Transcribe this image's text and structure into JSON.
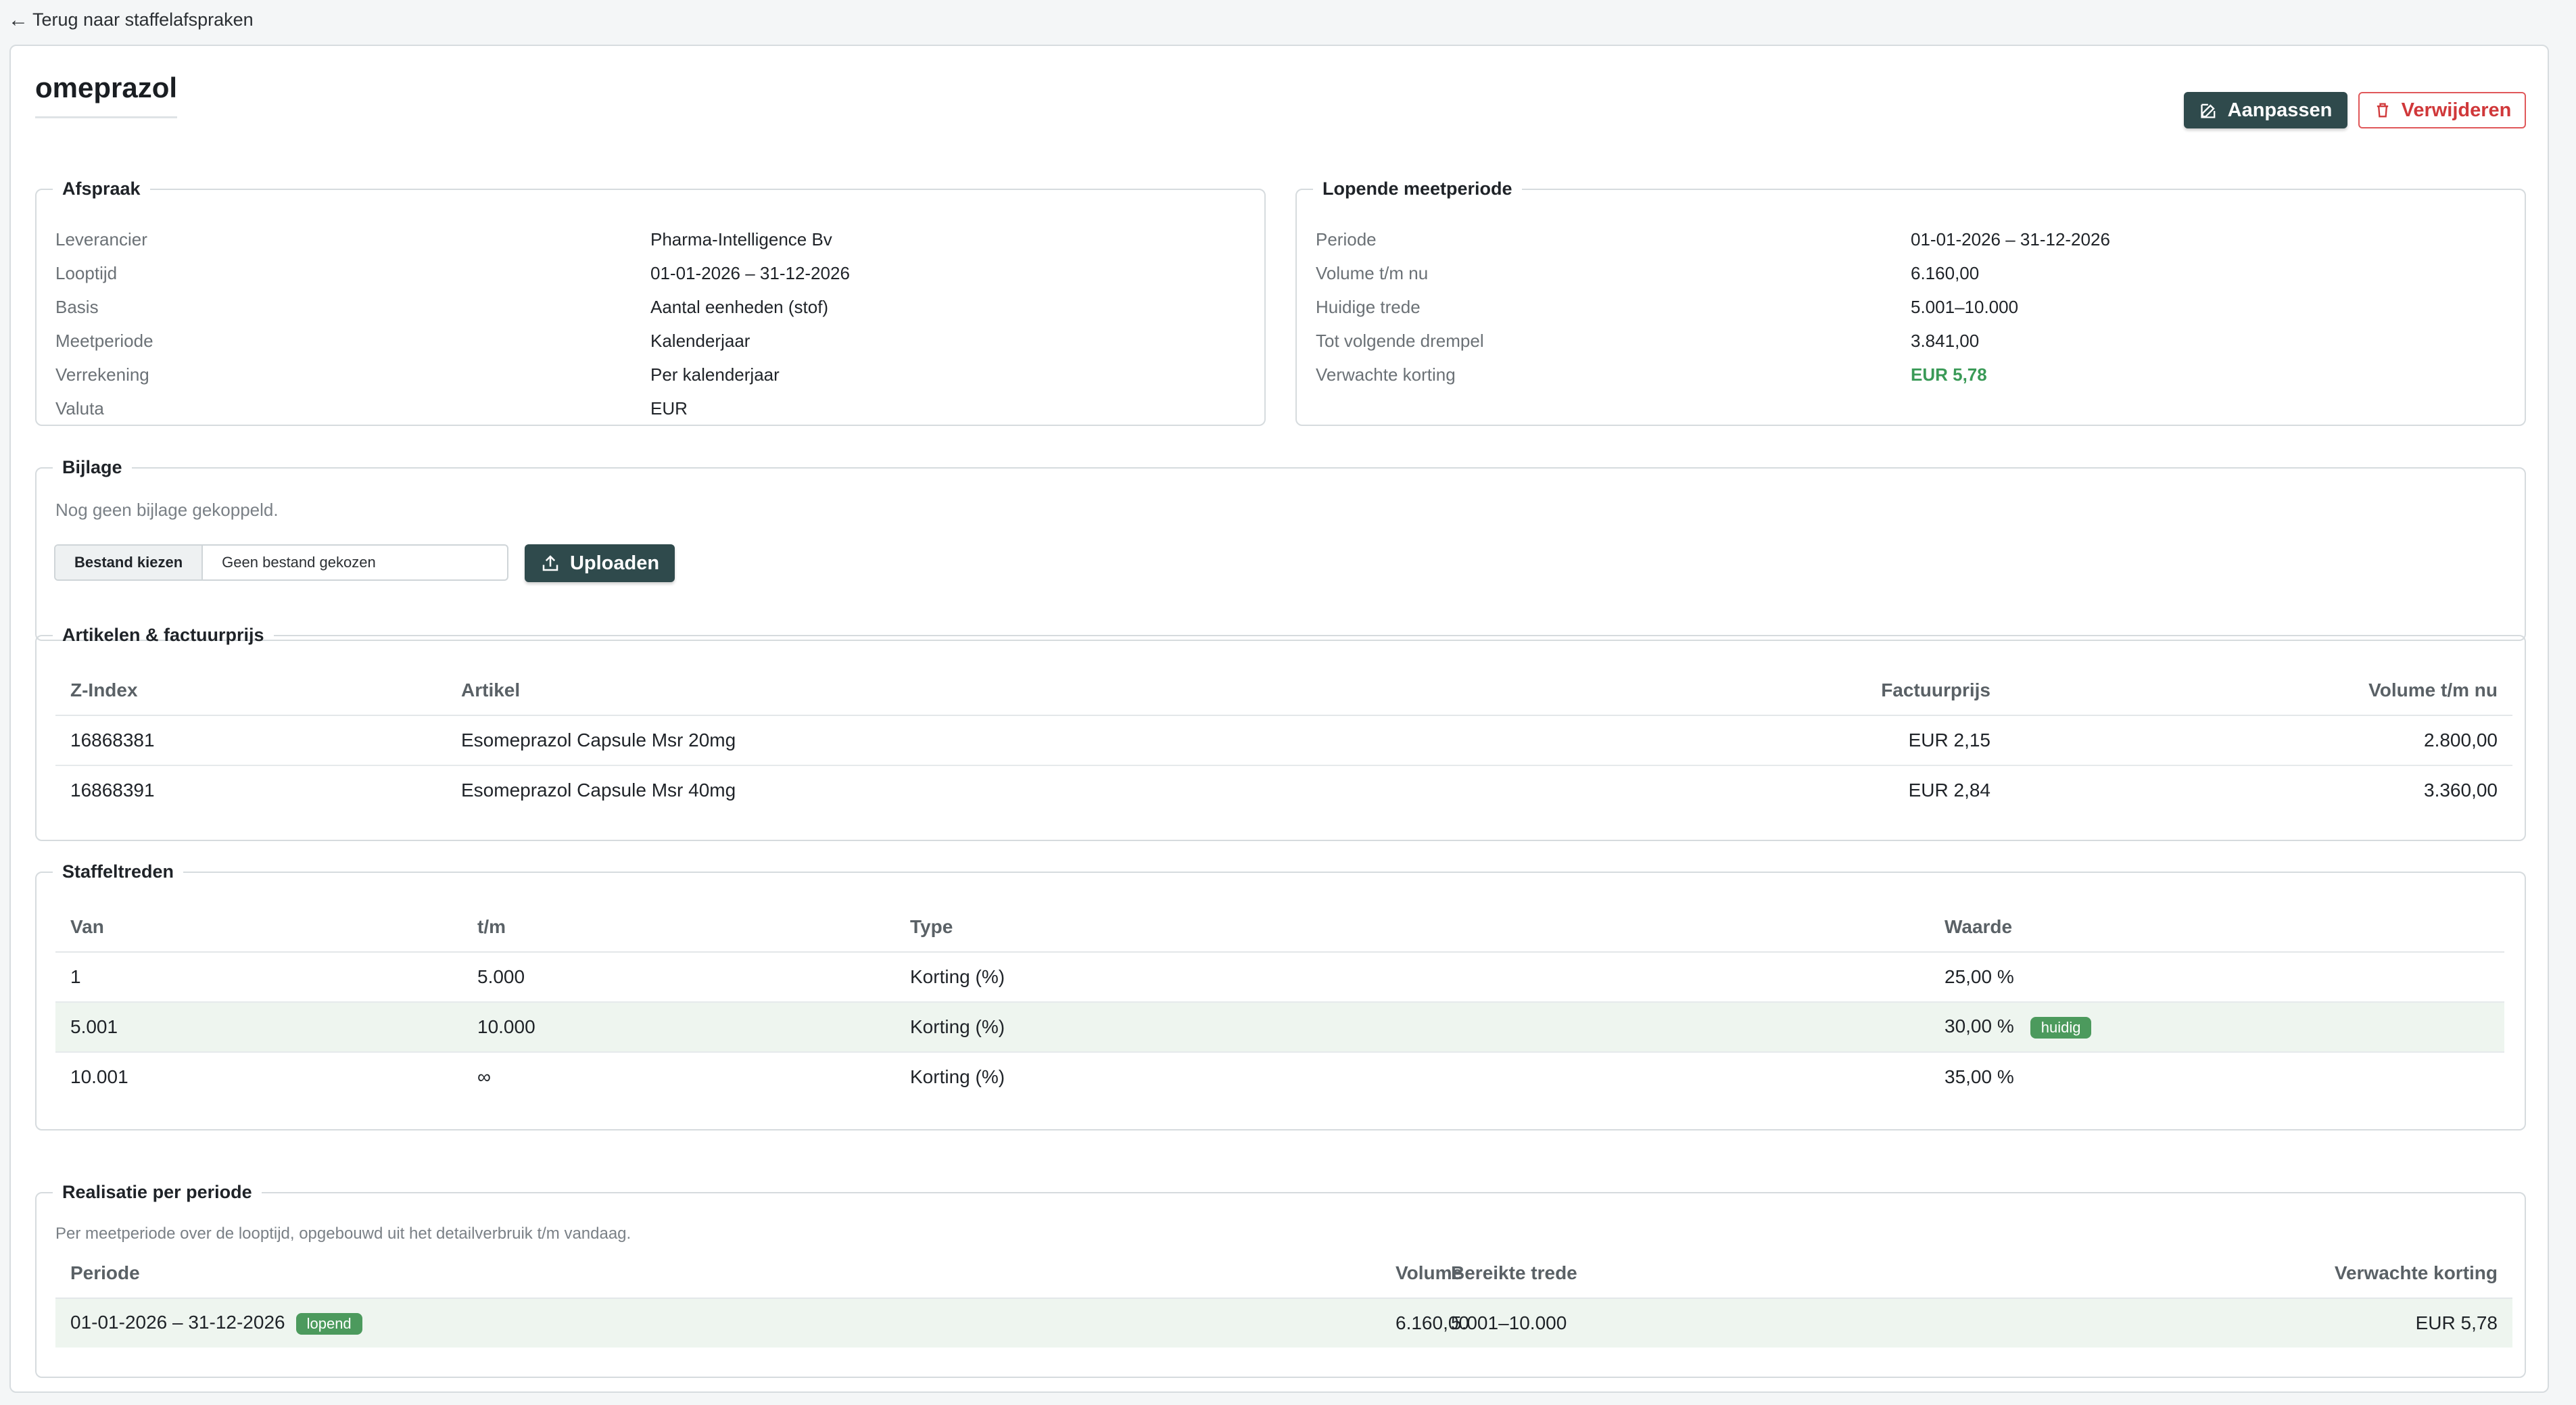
{
  "nav": {
    "back_label": "Terug naar staffelafspraken"
  },
  "page": {
    "title": "omeprazol"
  },
  "actions": {
    "edit_label": "Aanpassen",
    "delete_label": "Verwijderen"
  },
  "afspraak": {
    "legend": "Afspraak",
    "rows": [
      {
        "k": "Leverancier",
        "v": "Pharma-Intelligence Bv"
      },
      {
        "k": "Looptijd",
        "v": "01-01-2026 – 31-12-2026"
      },
      {
        "k": "Basis",
        "v": "Aantal eenheden (stof)"
      },
      {
        "k": "Meetperiode",
        "v": "Kalenderjaar"
      },
      {
        "k": "Verrekening",
        "v": "Per kalenderjaar"
      },
      {
        "k": "Valuta",
        "v": "EUR"
      }
    ]
  },
  "meetperiode": {
    "legend": "Lopende meetperiode",
    "rows": [
      {
        "k": "Periode",
        "v": "01-01-2026 – 31-12-2026"
      },
      {
        "k": "Volume t/m nu",
        "v": "6.160,00"
      },
      {
        "k": "Huidige trede",
        "v": "5.001–10.000"
      },
      {
        "k": "Tot volgende drempel",
        "v": "3.841,00"
      },
      {
        "k": "Verwachte korting",
        "v": "EUR 5,78"
      }
    ],
    "highlight_color": "#3a9a57"
  },
  "bijlage": {
    "legend": "Bijlage",
    "note": "Nog geen bijlage gekoppeld.",
    "choose_label": "Bestand kiezen",
    "no_file_label": "Geen bestand gekozen",
    "upload_label": "Uploaden"
  },
  "artikelen": {
    "legend": "Artikelen & factuurprijs",
    "headers": [
      "Z-Index",
      "Artikel",
      "Factuurprijs",
      "Volume t/m nu"
    ],
    "rows": [
      [
        "16868381",
        "Esomeprazol Capsule Msr 20mg",
        "EUR 2,15",
        "2.800,00"
      ],
      [
        "16868391",
        "Esomeprazol Capsule Msr 40mg",
        "EUR 2,84",
        "3.360,00"
      ]
    ]
  },
  "staffel": {
    "legend": "Staffeltreden",
    "headers": [
      "Van",
      "t/m",
      "Type",
      "Waarde"
    ],
    "rows": [
      [
        "1",
        "5.000",
        "Korting (%)",
        "25,00 %"
      ],
      [
        "5.001",
        "10.000",
        "Korting (%)",
        "30,00 %"
      ],
      [
        "10.001",
        "∞",
        "Korting (%)",
        "35,00 %"
      ]
    ],
    "current_badge": "huidig"
  },
  "realisatie": {
    "legend": "Realisatie per periode",
    "note": "Per meetperiode over de looptijd, opgebouwd uit het detailverbruik t/m vandaag.",
    "headers": [
      "Periode",
      "Volume",
      "Bereikte trede",
      "Verwachte korting"
    ],
    "rows": [
      [
        "01-01-2026 – 31-12-2026",
        "6.160,00",
        "5.001–10.000",
        "EUR 5,78"
      ]
    ],
    "status_badge": "lopend"
  },
  "colors": {
    "primary": "#2f4a4c",
    "danger": "#d0383a",
    "success": "#4c9a5d",
    "highlight_row": "#eef5ef"
  }
}
